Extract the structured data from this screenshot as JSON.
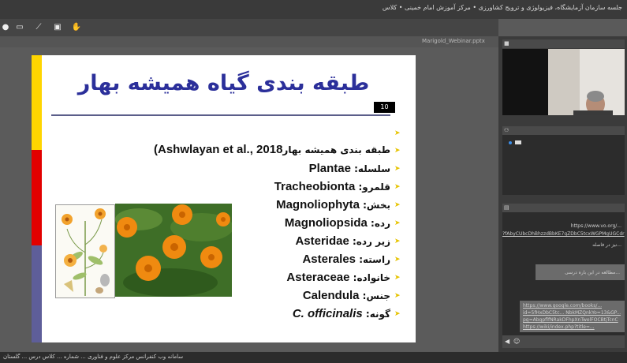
{
  "window": {
    "title": "جلسه سازمان آزمایشگاه، فیزیولوژی و ترویج کشاورزی • مرکز آموزش امام خمینی  •  کلاس"
  },
  "toolbar": {
    "tools": [
      "pointer-icon",
      "rectangle-icon",
      "pen-icon",
      "page-icon",
      "hand-icon"
    ]
  },
  "document": {
    "name": "Marigold_Webinar.pptx"
  },
  "slide": {
    "title": "طبقه بندی گیاه همیشه بهار",
    "number": "10",
    "bars": [
      "#ffd500",
      "#e20000",
      "#5e5e99"
    ],
    "lines": [
      {
        "label": "طبقه بندی همیشه بهار",
        "value": "(Ashwlayan et al., 2018",
        "italic": false
      },
      {
        "label": "سلسله: ",
        "value": "Plantae",
        "italic": false
      },
      {
        "label": "قلمرو: ",
        "value": "Tracheobionta",
        "italic": false
      },
      {
        "label": "بخش: ",
        "value": "Magnoliophyta",
        "italic": false
      },
      {
        "label": "رده: ",
        "value": "Magnoliopsida",
        "italic": false
      },
      {
        "label": "زیر رده: ",
        "value": "Asteridae",
        "italic": false
      },
      {
        "label": "راسته: ",
        "value": "Asterales",
        "italic": false
      },
      {
        "label": "خانواده: ",
        "value": "Asteraceae",
        "italic": false
      },
      {
        "label": "جنس: ",
        "value": "Calendula",
        "italic": false
      },
      {
        "label": "گونه: ",
        "value": "C. officinalis",
        "italic": true
      }
    ]
  },
  "panels": {
    "chat_messages": [
      "https://www.vo.org/...",
      "?fAbyCUbcDhBhzzdBbKE7gZDbC5tcxWGPMgUGCdr",
      "نیز در فاصله...",
      "مطالعه در این باره درسی...",
      "https://www.google.com/books/...",
      "id=5fHxDbC5tc... NbkMZQnkYo=13&GP...",
      "pg=AbgpflfNRakDFhpXnTwelFOCBtjTcnC",
      "https://wiki/index.php?title=..."
    ]
  },
  "statusbar": {
    "text": "سامانه وب کنفرانس مرکز علوم و فناوری ... شماره ... کلاس درس ... گلستان"
  },
  "colors": {
    "slide_title": "#2b2f9a",
    "bullet": "#e6c300"
  }
}
